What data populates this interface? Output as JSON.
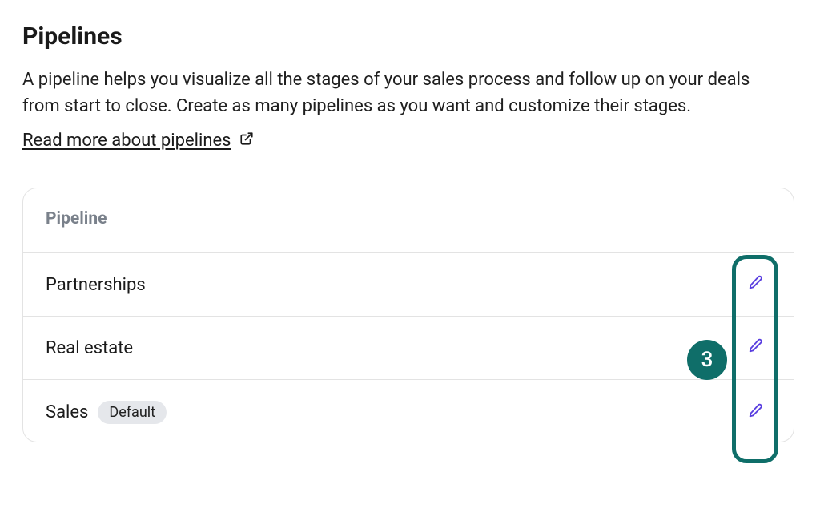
{
  "title": "Pipelines",
  "description": "A pipeline helps you visualize all the stages of your sales process and follow up on your deals from start to close. Create as many pipelines as you want and customize their stages.",
  "read_more": "Read more about pipelines",
  "table": {
    "header": "Pipeline",
    "rows": [
      {
        "name": "Partnerships",
        "default": false
      },
      {
        "name": "Real estate",
        "default": false
      },
      {
        "name": "Sales",
        "default": true
      }
    ]
  },
  "default_label": "Default",
  "step_badge": "3"
}
